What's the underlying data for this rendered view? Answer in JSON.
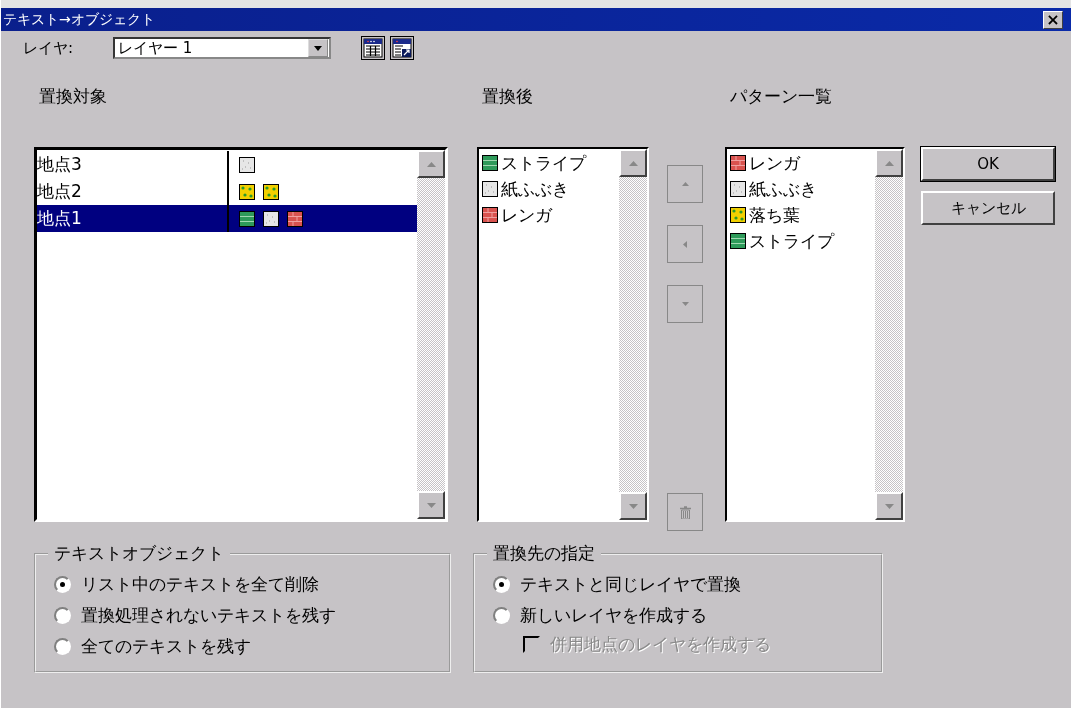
{
  "window": {
    "title": "テキスト→オブジェクト",
    "close": "×"
  },
  "layer": {
    "label": "レイヤ:",
    "value": "レイヤー 1"
  },
  "targets": {
    "heading": "置換対象",
    "rows": [
      {
        "name": "地点3",
        "selected": false,
        "swatches": [
          {
            "kind": "paper"
          }
        ]
      },
      {
        "name": "地点2",
        "selected": false,
        "swatches": [
          {
            "kind": "leaves"
          },
          {
            "kind": "leaves"
          }
        ]
      },
      {
        "name": "地点1",
        "selected": true,
        "swatches": [
          {
            "kind": "stripe"
          },
          {
            "kind": "paper"
          },
          {
            "kind": "brick"
          }
        ]
      }
    ]
  },
  "replacements": {
    "heading": "置換後",
    "items": [
      {
        "label": "ストライプ",
        "kind": "stripe",
        "selected": false
      },
      {
        "label": "紙ふぶき",
        "kind": "paper",
        "selected": false
      },
      {
        "label": "レンガ",
        "kind": "brick",
        "selected": false
      }
    ]
  },
  "transfer_buttons": [
    {
      "kind": "up",
      "disabled": true
    },
    {
      "kind": "left",
      "disabled": true
    },
    {
      "kind": "down",
      "disabled": true
    },
    {
      "kind": "delete",
      "disabled": true
    }
  ],
  "patterns": {
    "heading": "パターン一覧",
    "items": [
      {
        "label": "レンガ",
        "kind": "brick",
        "selected": false
      },
      {
        "label": "紙ふぶき",
        "kind": "paper",
        "selected": false
      },
      {
        "label": "落ち葉",
        "kind": "leaves",
        "selected": false
      },
      {
        "label": "ストライプ",
        "kind": "stripe",
        "selected": false
      }
    ]
  },
  "buttons": [
    "OK",
    "キャンセル"
  ],
  "text_object_group": {
    "title": "テキストオブジェクト",
    "options": [
      {
        "label": "リスト中のテキストを全て削除",
        "selected": true
      },
      {
        "label": "置換処理されないテキストを残す",
        "selected": false
      },
      {
        "label": "全てのテキストを残す",
        "selected": false
      }
    ]
  },
  "destination_group": {
    "title": "置換先の指定",
    "options": [
      {
        "label": "テキストと同じレイヤで置換",
        "selected": true
      },
      {
        "label": "新しいレイヤを作成する",
        "selected": false
      }
    ],
    "checkbox": {
      "label": "併用地点のレイヤを作成する",
      "checked": false,
      "disabled": true
    }
  }
}
